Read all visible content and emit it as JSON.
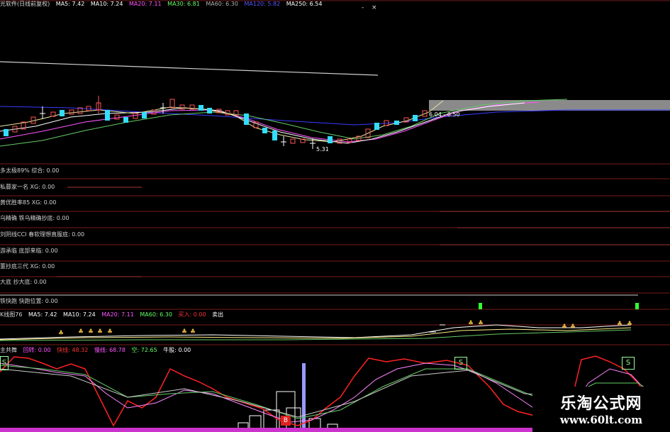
{
  "main_legend": {
    "title": "光软件(日线前复权)",
    "items": [
      {
        "text": "MA5: 7.42",
        "color": "#ffffff"
      },
      {
        "text": "MA10: 7.24",
        "color": "#ffffff"
      },
      {
        "text": "MA20: 7.11",
        "color": "#ff55ff"
      },
      {
        "text": "MA30: 6.81",
        "color": "#66ff66"
      },
      {
        "text": "MA60: 6.30",
        "color": "#b0b0b0"
      },
      {
        "text": "MA120: 5.82",
        "color": "#5555ff"
      },
      {
        "text": "MA250: 6.54",
        "color": "#ffffff"
      }
    ]
  },
  "window_controls": [
    "-",
    "×"
  ],
  "annotations": {
    "low_price": "5.31",
    "range": "6.04 - 6.50"
  },
  "indicator_panels": [
    "多太极89%  综合: 0.00",
    "私募家一名 XG: 0.00",
    "黄优胜率85 XG: 0.00",
    "乌精确  铁乌精确抄底: 0.00",
    "刘阴线CCI  春软理想直服底: 0.00",
    "游承临  底部来临: 0.00",
    "董抄底三代  XG: 0.00",
    "大底  抄大底: 0.00",
    "铁快跑  快跑位置: 0.00"
  ],
  "ma_legend": {
    "prefix": "K线图76",
    "items": [
      {
        "text": "MA5: 7.42",
        "color": "#ffffff"
      },
      {
        "text": "MA10: 7.24",
        "color": "#ffffff"
      },
      {
        "text": "MA20: 7.11",
        "color": "#ff55ff"
      },
      {
        "text": "MA60: 6.30",
        "color": "#66ff66"
      },
      {
        "text": "买入: 0.00",
        "color": "#ff3333"
      },
      {
        "text": "卖出",
        "color": "#ffffff"
      }
    ]
  },
  "kdj_legend": {
    "prefix": "主共舞",
    "items": [
      {
        "text": "回转: 0.00",
        "color": "#ff55ff"
      },
      {
        "text": "快线: 48.32",
        "color": "#ff3333"
      },
      {
        "text": "慢线: 68.78",
        "color": "#ff55ff"
      },
      {
        "text": "空: 72.65",
        "color": "#66ff66"
      },
      {
        "text": "牛股: 0.00",
        "color": "#ffffff"
      }
    ]
  },
  "markers": {
    "sell": "S",
    "buy": "B"
  },
  "watermark": {
    "title": "乐淘公式网",
    "url": "www.60lt.com"
  }
}
